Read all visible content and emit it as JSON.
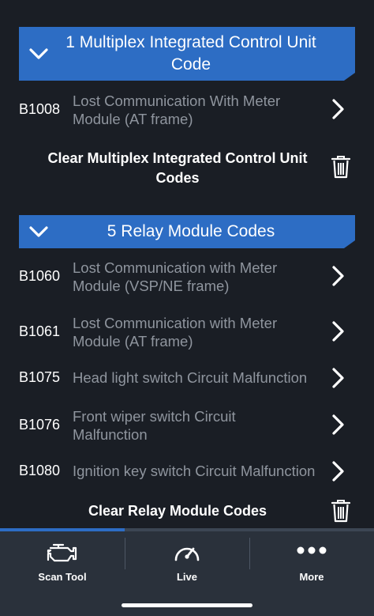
{
  "sections": [
    {
      "title": "1 Multiplex Integrated Control Unit Code",
      "codes": [
        {
          "code": "B1008",
          "description": "Lost Communication With Meter Module (AT frame)"
        }
      ],
      "clear_label": "Clear Multiplex Integrated Control Unit Codes"
    },
    {
      "title": "5 Relay Module Codes",
      "codes": [
        {
          "code": "B1060",
          "description": "Lost Communication with Meter Module (VSP/NE frame)"
        },
        {
          "code": "B1061",
          "description": "Lost Communication with Meter Module (AT frame)"
        },
        {
          "code": "B1075",
          "description": "Head light switch Circuit Malfunction"
        },
        {
          "code": "B1076",
          "description": "Front wiper switch Circuit Malfunction"
        },
        {
          "code": "B1080",
          "description": "Ignition key switch Circuit Malfunction"
        }
      ],
      "clear_label": "Clear Relay Module Codes"
    }
  ],
  "tabs": [
    {
      "label": "Scan Tool",
      "icon": "engine-icon",
      "active": true
    },
    {
      "label": "Live",
      "icon": "gauge-icon",
      "active": false
    },
    {
      "label": "More",
      "icon": "more-dots-icon",
      "active": false
    }
  ],
  "colors": {
    "accent": "#2d6dc4",
    "background": "#1a1e25",
    "tabbar": "#2a313b",
    "muted_text": "#8f959e"
  }
}
